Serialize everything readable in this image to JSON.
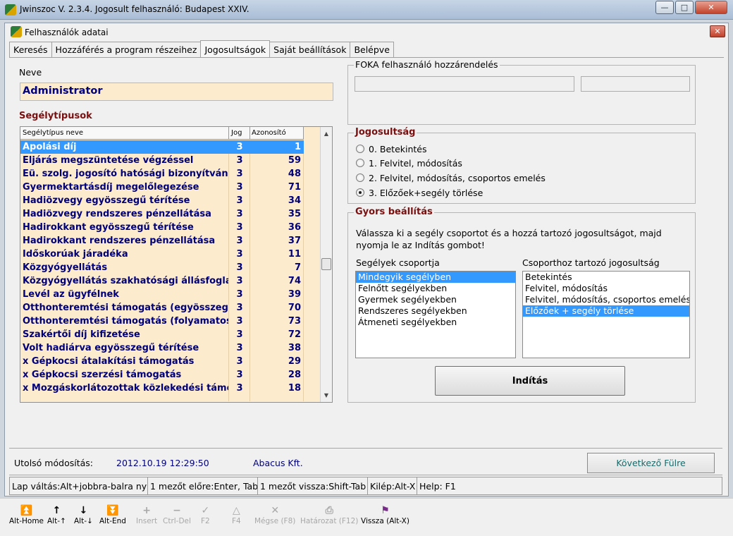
{
  "window": {
    "title": "Jwinszoc V. 2.3.4.  Jogosult felhasználó: Budapest XXIV.",
    "minimize": "—",
    "maximize": "□",
    "close": "✕"
  },
  "inner": {
    "title": "Felhasználók adatai",
    "close": "✕"
  },
  "tabs": [
    {
      "label": "Keresés",
      "active": false
    },
    {
      "label": "Hozzáférés a program részeihez",
      "active": false
    },
    {
      "label": "Jogosultságok",
      "active": true
    },
    {
      "label": "Saját beállítások",
      "active": false
    },
    {
      "label": "Belépve",
      "active": false
    }
  ],
  "neve": {
    "label": "Neve",
    "value": "Administrator"
  },
  "segelytipusok": {
    "title": "Segélytípusok",
    "headers": {
      "name": "Segélytípus neve",
      "jog": "Jog",
      "azon": "Azonosító"
    },
    "rows": [
      {
        "name": "Ápolási díj",
        "jog": "3",
        "azon": "1",
        "selected": true
      },
      {
        "name": "Eljárás megszüntetése végzéssel",
        "jog": "3",
        "azon": "59"
      },
      {
        "name": "Eü. szolg. jogosító hatósági bizonyítvány",
        "jog": "3",
        "azon": "48"
      },
      {
        "name": "Gyermektartásdíj megelőlegezése",
        "jog": "3",
        "azon": "71"
      },
      {
        "name": "Hadiözvegy egyösszegű térítése",
        "jog": "3",
        "azon": "34"
      },
      {
        "name": "Hadiözvegy rendszeres pénzellátása",
        "jog": "3",
        "azon": "35"
      },
      {
        "name": "Hadirokkant egyösszegű térítése",
        "jog": "3",
        "azon": "36"
      },
      {
        "name": "Hadirokkant rendszeres pénzellátása",
        "jog": "3",
        "azon": "37"
      },
      {
        "name": "Időskorúak járadéka",
        "jog": "3",
        "azon": "11"
      },
      {
        "name": "Közgyógyellátás",
        "jog": "3",
        "azon": "7"
      },
      {
        "name": "Közgyógyellátás szakhatósági állásfoglalás",
        "jog": "3",
        "azon": "74"
      },
      {
        "name": "Levél az ügyfélnek",
        "jog": "3",
        "azon": "39"
      },
      {
        "name": "Otthonteremtési támogatás (egyösszegű)",
        "jog": "3",
        "azon": "70"
      },
      {
        "name": "Otthonteremtési támogatás (folyamatos)",
        "jog": "3",
        "azon": "73"
      },
      {
        "name": "Szakértői díj kifizetése",
        "jog": "3",
        "azon": "72"
      },
      {
        "name": "Volt hadiárva egyösszegű térítése",
        "jog": "3",
        "azon": "38"
      },
      {
        "name": "x Gépkocsi átalakítási támogatás",
        "jog": "3",
        "azon": "29"
      },
      {
        "name": "x Gépkocsi szerzési támogatás",
        "jog": "3",
        "azon": "28"
      },
      {
        "name": "x Mozgáskorlátozottak közlekedési támogatása",
        "jog": "3",
        "azon": "18"
      }
    ]
  },
  "foka": {
    "title": "FOKA felhasználó hozzárendelés"
  },
  "jogosultsag": {
    "title": "Jogosultság",
    "options": [
      {
        "label": "0. Betekintés",
        "checked": false
      },
      {
        "label": "1. Felvitel, módosítás",
        "checked": false
      },
      {
        "label": "2. Felvitel, módosítás, csoportos emelés",
        "checked": false
      },
      {
        "label": "3. Előzőek+segély törlése",
        "checked": true
      }
    ]
  },
  "gyors": {
    "title": "Gyors beállítás",
    "instruction_line1": "Válassza ki a segély csoportot és a  hozzá tartozó jogosultságot, majd",
    "instruction_line2": "nyomja le az Indítás gombot!",
    "groups_label": "Segélyek csoportja",
    "groups": [
      {
        "label": "Mindegyik segélyben",
        "selected": true
      },
      {
        "label": "Felnőtt segélyekben"
      },
      {
        "label": "Gyermek segélyekben"
      },
      {
        "label": "Rendszeres segélyekben"
      },
      {
        "label": "Átmeneti segélyekben"
      }
    ],
    "rights_label": "Csoporthoz tartozó jogosultság",
    "rights": [
      {
        "label": "Betekintés"
      },
      {
        "label": "Felvitel, módosítás"
      },
      {
        "label": "Felvitel, módosítás, csoportos emelés"
      },
      {
        "label": "Előzőek + segély törlése",
        "selected": true
      }
    ],
    "start_button": "Indítás"
  },
  "footer": {
    "last_mod_label": "Utolsó módosítás:",
    "last_mod_value": "2012.10.19 12:29:50",
    "last_mod_by": "Abacus Kft.",
    "next_tab_button": "Következő Fülre"
  },
  "statusbar": [
    "Lap váltás:Alt+jobbra-balra nyíl",
    "1 mezőt előre:Enter, Tab",
    "1 mezőt vissza:Shift-Tab",
    "Kilép:Alt-X",
    "Help: F1"
  ],
  "toolbar": [
    {
      "label": "Alt-Home",
      "icon": "⏫",
      "disabled": false
    },
    {
      "label": "Alt-↑",
      "icon": "↑",
      "disabled": false
    },
    {
      "label": "Alt-↓",
      "icon": "↓",
      "disabled": false
    },
    {
      "label": "Alt-End",
      "icon": "⏬",
      "disabled": false
    },
    {
      "label": "Insert",
      "icon": "+",
      "disabled": true
    },
    {
      "label": "Ctrl-Del",
      "icon": "−",
      "disabled": true
    },
    {
      "label": "F2",
      "icon": "✓",
      "disabled": true
    },
    {
      "label": "F4",
      "icon": "△",
      "disabled": true
    },
    {
      "label": "Mégse (F8)",
      "icon": "✕",
      "disabled": true
    },
    {
      "label": "Határozat (F12)",
      "icon": "⎙",
      "disabled": true
    },
    {
      "label": "Vissza (Alt-X)",
      "icon": "⚑",
      "disabled": false
    }
  ]
}
